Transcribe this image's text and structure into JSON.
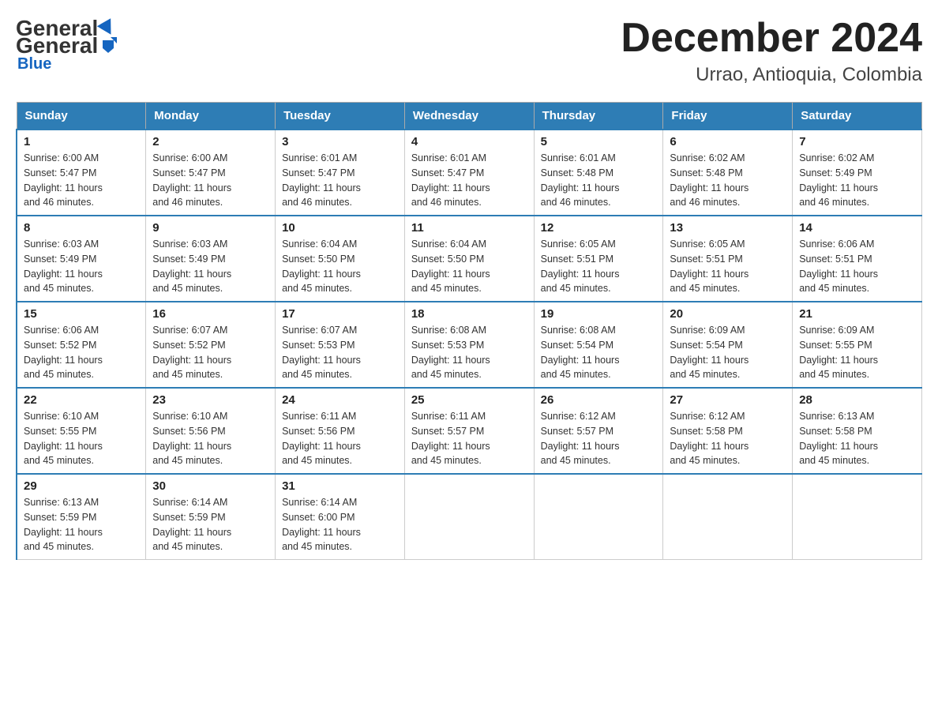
{
  "header": {
    "logo_general": "General",
    "logo_blue": "Blue",
    "title": "December 2024",
    "subtitle": "Urrao, Antioquia, Colombia"
  },
  "columns": [
    "Sunday",
    "Monday",
    "Tuesday",
    "Wednesday",
    "Thursday",
    "Friday",
    "Saturday"
  ],
  "weeks": [
    [
      {
        "day": "1",
        "sunrise": "6:00 AM",
        "sunset": "5:47 PM",
        "daylight": "11 hours and 46 minutes."
      },
      {
        "day": "2",
        "sunrise": "6:00 AM",
        "sunset": "5:47 PM",
        "daylight": "11 hours and 46 minutes."
      },
      {
        "day": "3",
        "sunrise": "6:01 AM",
        "sunset": "5:47 PM",
        "daylight": "11 hours and 46 minutes."
      },
      {
        "day": "4",
        "sunrise": "6:01 AM",
        "sunset": "5:47 PM",
        "daylight": "11 hours and 46 minutes."
      },
      {
        "day": "5",
        "sunrise": "6:01 AM",
        "sunset": "5:48 PM",
        "daylight": "11 hours and 46 minutes."
      },
      {
        "day": "6",
        "sunrise": "6:02 AM",
        "sunset": "5:48 PM",
        "daylight": "11 hours and 46 minutes."
      },
      {
        "day": "7",
        "sunrise": "6:02 AM",
        "sunset": "5:49 PM",
        "daylight": "11 hours and 46 minutes."
      }
    ],
    [
      {
        "day": "8",
        "sunrise": "6:03 AM",
        "sunset": "5:49 PM",
        "daylight": "11 hours and 45 minutes."
      },
      {
        "day": "9",
        "sunrise": "6:03 AM",
        "sunset": "5:49 PM",
        "daylight": "11 hours and 45 minutes."
      },
      {
        "day": "10",
        "sunrise": "6:04 AM",
        "sunset": "5:50 PM",
        "daylight": "11 hours and 45 minutes."
      },
      {
        "day": "11",
        "sunrise": "6:04 AM",
        "sunset": "5:50 PM",
        "daylight": "11 hours and 45 minutes."
      },
      {
        "day": "12",
        "sunrise": "6:05 AM",
        "sunset": "5:51 PM",
        "daylight": "11 hours and 45 minutes."
      },
      {
        "day": "13",
        "sunrise": "6:05 AM",
        "sunset": "5:51 PM",
        "daylight": "11 hours and 45 minutes."
      },
      {
        "day": "14",
        "sunrise": "6:06 AM",
        "sunset": "5:51 PM",
        "daylight": "11 hours and 45 minutes."
      }
    ],
    [
      {
        "day": "15",
        "sunrise": "6:06 AM",
        "sunset": "5:52 PM",
        "daylight": "11 hours and 45 minutes."
      },
      {
        "day": "16",
        "sunrise": "6:07 AM",
        "sunset": "5:52 PM",
        "daylight": "11 hours and 45 minutes."
      },
      {
        "day": "17",
        "sunrise": "6:07 AM",
        "sunset": "5:53 PM",
        "daylight": "11 hours and 45 minutes."
      },
      {
        "day": "18",
        "sunrise": "6:08 AM",
        "sunset": "5:53 PM",
        "daylight": "11 hours and 45 minutes."
      },
      {
        "day": "19",
        "sunrise": "6:08 AM",
        "sunset": "5:54 PM",
        "daylight": "11 hours and 45 minutes."
      },
      {
        "day": "20",
        "sunrise": "6:09 AM",
        "sunset": "5:54 PM",
        "daylight": "11 hours and 45 minutes."
      },
      {
        "day": "21",
        "sunrise": "6:09 AM",
        "sunset": "5:55 PM",
        "daylight": "11 hours and 45 minutes."
      }
    ],
    [
      {
        "day": "22",
        "sunrise": "6:10 AM",
        "sunset": "5:55 PM",
        "daylight": "11 hours and 45 minutes."
      },
      {
        "day": "23",
        "sunrise": "6:10 AM",
        "sunset": "5:56 PM",
        "daylight": "11 hours and 45 minutes."
      },
      {
        "day": "24",
        "sunrise": "6:11 AM",
        "sunset": "5:56 PM",
        "daylight": "11 hours and 45 minutes."
      },
      {
        "day": "25",
        "sunrise": "6:11 AM",
        "sunset": "5:57 PM",
        "daylight": "11 hours and 45 minutes."
      },
      {
        "day": "26",
        "sunrise": "6:12 AM",
        "sunset": "5:57 PM",
        "daylight": "11 hours and 45 minutes."
      },
      {
        "day": "27",
        "sunrise": "6:12 AM",
        "sunset": "5:58 PM",
        "daylight": "11 hours and 45 minutes."
      },
      {
        "day": "28",
        "sunrise": "6:13 AM",
        "sunset": "5:58 PM",
        "daylight": "11 hours and 45 minutes."
      }
    ],
    [
      {
        "day": "29",
        "sunrise": "6:13 AM",
        "sunset": "5:59 PM",
        "daylight": "11 hours and 45 minutes."
      },
      {
        "day": "30",
        "sunrise": "6:14 AM",
        "sunset": "5:59 PM",
        "daylight": "11 hours and 45 minutes."
      },
      {
        "day": "31",
        "sunrise": "6:14 AM",
        "sunset": "6:00 PM",
        "daylight": "11 hours and 45 minutes."
      },
      null,
      null,
      null,
      null
    ]
  ],
  "labels": {
    "sunrise": "Sunrise:",
    "sunset": "Sunset:",
    "daylight": "Daylight:"
  }
}
